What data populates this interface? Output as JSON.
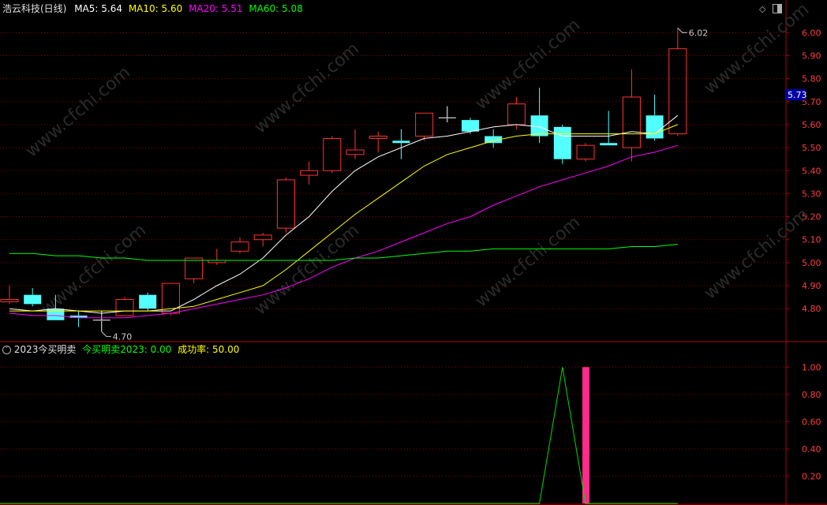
{
  "main_panel": {
    "stock_title": "浩云科技(日线)",
    "ma_legend": [
      {
        "label": "MA5: 5.64",
        "color": "#ffffff"
      },
      {
        "label": "MA10: 5.60",
        "color": "#ffff00"
      },
      {
        "label": "MA20: 5.51",
        "color": "#ff00ff"
      },
      {
        "label": "MA60: 5.08",
        "color": "#00ff00"
      }
    ],
    "y_ticks": [
      "6.00",
      "5.90",
      "5.80",
      "5.70",
      "5.60",
      "5.50",
      "5.40",
      "5.30",
      "5.20",
      "5.10",
      "5.00",
      "4.90",
      "4.80"
    ],
    "current_price_tag": "5.73",
    "high_annotation": "6.02",
    "low_annotation": "4.70",
    "watermark": "www.cfchi.com"
  },
  "indicator_panel": {
    "title": "2023今买明卖",
    "series_label": "今买明卖2023: 0.00",
    "success_label": "成功率: 50.00",
    "y_ticks": [
      "1.00",
      "0.80",
      "0.60",
      "0.40",
      "0.20"
    ]
  },
  "icons": [
    "diamond-icon",
    "window-toggle-icon",
    "panel-collapse-icon"
  ],
  "colors": {
    "up": "#ff3232",
    "down": "#54ffff",
    "ma5": "#ffffff",
    "ma10": "#ffff00",
    "ma20": "#ff00ff",
    "ma60": "#00ff00",
    "grid": "#8b0000",
    "axis_text": "#ff3c3c",
    "price_tag_bg": "#0000aa",
    "signal_bar": "#ff2a8a"
  },
  "chart_data": [
    {
      "type": "candlestick",
      "title": "浩云科技(日线)",
      "ylim": [
        4.66,
        6.08
      ],
      "candles": [
        {
          "open": 4.83,
          "close": 4.84,
          "high": 4.9,
          "low": 4.82
        },
        {
          "open": 4.86,
          "close": 4.82,
          "high": 4.89,
          "low": 4.81
        },
        {
          "open": 4.8,
          "close": 4.75,
          "high": 4.86,
          "low": 4.75
        },
        {
          "open": 4.77,
          "close": 4.76,
          "high": 4.79,
          "low": 4.72
        },
        {
          "open": 4.75,
          "close": 4.75,
          "high": 4.79,
          "low": 4.7
        },
        {
          "open": 4.77,
          "close": 4.84,
          "high": 4.85,
          "low": 4.77
        },
        {
          "open": 4.86,
          "close": 4.8,
          "high": 4.87,
          "low": 4.79
        },
        {
          "open": 4.78,
          "close": 4.91,
          "high": 4.91,
          "low": 4.77
        },
        {
          "open": 4.93,
          "close": 5.02,
          "high": 5.02,
          "low": 4.91
        },
        {
          "open": 5.0,
          "close": 5.01,
          "high": 5.06,
          "low": 4.99
        },
        {
          "open": 5.05,
          "close": 5.09,
          "high": 5.11,
          "low": 5.04
        },
        {
          "open": 5.1,
          "close": 5.12,
          "high": 5.13,
          "low": 5.07
        },
        {
          "open": 5.15,
          "close": 5.36,
          "high": 5.37,
          "low": 5.13
        },
        {
          "open": 5.38,
          "close": 5.4,
          "high": 5.44,
          "low": 5.34
        },
        {
          "open": 5.4,
          "close": 5.54,
          "high": 5.55,
          "low": 5.39
        },
        {
          "open": 5.47,
          "close": 5.49,
          "high": 5.58,
          "low": 5.45
        },
        {
          "open": 5.54,
          "close": 5.55,
          "high": 5.57,
          "low": 5.48
        },
        {
          "open": 5.53,
          "close": 5.52,
          "high": 5.58,
          "low": 5.45
        },
        {
          "open": 5.55,
          "close": 5.65,
          "high": 5.65,
          "low": 5.53
        },
        {
          "open": 5.63,
          "close": 5.63,
          "high": 5.68,
          "low": 5.61
        },
        {
          "open": 5.62,
          "close": 5.57,
          "high": 5.63,
          "low": 5.56
        },
        {
          "open": 5.55,
          "close": 5.52,
          "high": 5.58,
          "low": 5.5
        },
        {
          "open": 5.6,
          "close": 5.69,
          "high": 5.72,
          "low": 5.58
        },
        {
          "open": 5.64,
          "close": 5.55,
          "high": 5.76,
          "low": 5.52
        },
        {
          "open": 5.59,
          "close": 5.45,
          "high": 5.6,
          "low": 5.43
        },
        {
          "open": 5.45,
          "close": 5.51,
          "high": 5.52,
          "low": 5.44
        },
        {
          "open": 5.52,
          "close": 5.51,
          "high": 5.66,
          "low": 5.51
        },
        {
          "open": 5.5,
          "close": 5.72,
          "high": 5.84,
          "low": 5.44
        },
        {
          "open": 5.64,
          "close": 5.54,
          "high": 5.73,
          "low": 5.53
        },
        {
          "open": 5.56,
          "close": 5.93,
          "high": 6.02,
          "low": 5.55
        }
      ],
      "ma_lines": [
        {
          "name": "MA5",
          "values": [
            4.8,
            4.79,
            4.8,
            4.79,
            4.78,
            4.79,
            4.79,
            4.79,
            4.84,
            4.9,
            4.95,
            5.02,
            5.12,
            5.2,
            5.31,
            5.4,
            5.46,
            5.5,
            5.54,
            5.55,
            5.57,
            5.59,
            5.6,
            5.59,
            5.55,
            5.55,
            5.55,
            5.57,
            5.56,
            5.64
          ]
        },
        {
          "name": "MA10",
          "values": [
            4.79,
            4.79,
            4.79,
            4.79,
            4.79,
            4.79,
            4.79,
            4.8,
            4.81,
            4.84,
            4.87,
            4.9,
            4.97,
            5.05,
            5.13,
            5.21,
            5.28,
            5.35,
            5.42,
            5.47,
            5.5,
            5.53,
            5.55,
            5.56,
            5.56,
            5.56,
            5.56,
            5.56,
            5.56,
            5.6
          ]
        },
        {
          "name": "MA20",
          "values": [
            4.78,
            4.77,
            4.77,
            4.76,
            4.76,
            4.76,
            4.77,
            4.78,
            4.8,
            4.82,
            4.84,
            4.86,
            4.89,
            4.93,
            4.98,
            5.02,
            5.05,
            5.09,
            5.13,
            5.17,
            5.2,
            5.25,
            5.29,
            5.33,
            5.36,
            5.39,
            5.42,
            5.46,
            5.48,
            5.51
          ]
        },
        {
          "name": "MA60",
          "values": [
            5.04,
            5.04,
            5.03,
            5.03,
            5.02,
            5.02,
            5.01,
            5.01,
            5.01,
            5.01,
            5.01,
            5.01,
            5.01,
            5.01,
            5.01,
            5.02,
            5.02,
            5.03,
            5.04,
            5.05,
            5.05,
            5.06,
            5.06,
            5.06,
            5.06,
            5.06,
            5.06,
            5.07,
            5.07,
            5.08
          ]
        }
      ]
    },
    {
      "type": "line",
      "title": "2023今买明卖",
      "ylim": [
        0,
        1.1
      ],
      "series": [
        {
          "name": "今买明卖2023",
          "values": [
            0,
            0,
            0,
            0,
            0,
            0,
            0,
            0,
            0,
            0,
            0,
            0,
            0,
            0,
            0,
            0,
            0,
            0,
            0,
            0,
            0,
            0,
            0,
            0,
            1,
            0,
            0,
            0,
            0,
            0
          ]
        }
      ],
      "signal_bars": [
        {
          "index": 25,
          "value": 1.0
        }
      ]
    }
  ]
}
